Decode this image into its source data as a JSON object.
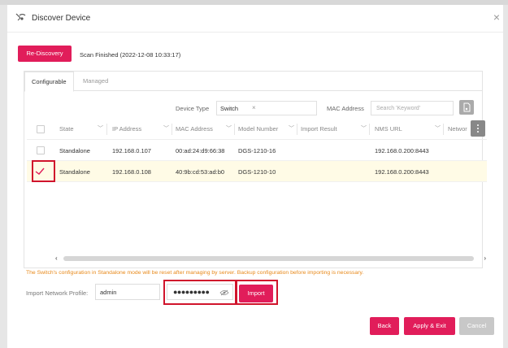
{
  "dialog": {
    "title": "Discover Device",
    "icon": "radar-discover-icon",
    "close_glyph": "×"
  },
  "toolbar": {
    "rediscovery_label": "Re-Discovery",
    "scan_status": "Scan Finished (2022-12-08 10:33:17)"
  },
  "tabs": [
    {
      "label": "Configurable",
      "active": true
    },
    {
      "label": "Managed",
      "active": false
    }
  ],
  "filters": {
    "device_type_label": "Device Type",
    "device_type_value": "Switch",
    "chip_remove": "×",
    "mac_label": "MAC Address",
    "mac_placeholder": "Search 'Keyword'"
  },
  "table": {
    "columns": [
      "State",
      "IP Address",
      "MAC Address",
      "Model Number",
      "Import Result",
      "NMS URL",
      "Networ"
    ],
    "rows": [
      {
        "selected": false,
        "state": "Standalone",
        "ip": "192.168.0.107",
        "mac": "00:ad:24:d9:66:38",
        "model": "DGS-1210-16",
        "import_result": "",
        "nms_url": "192.168.0.200:8443"
      },
      {
        "selected": true,
        "state": "Standalone",
        "ip": "192.168.0.108",
        "mac": "40:9b:cd:53:ad:b0",
        "model": "DGS-1210-10",
        "import_result": "",
        "nms_url": "192.168.0.200:8443"
      }
    ]
  },
  "scroll": {
    "left_arrow": "‹",
    "right_arrow": "›"
  },
  "warning": "The Switch's configuration in Standalone mode will be reset after managing by server. Backup configuration before importing is necessary.",
  "import_profile": {
    "label": "Import Network Profile:",
    "username": "admin",
    "password_mask": "●●●●●●●●●",
    "import_label": "Import"
  },
  "footer": {
    "back_label": "Back",
    "apply_label": "Apply & Exit",
    "cancel_label": "Cancel"
  },
  "colors": {
    "accent": "#e11d5a",
    "highlight_box": "#d0142c",
    "warning": "#e8891a",
    "selected_row": "#fffbe6"
  }
}
